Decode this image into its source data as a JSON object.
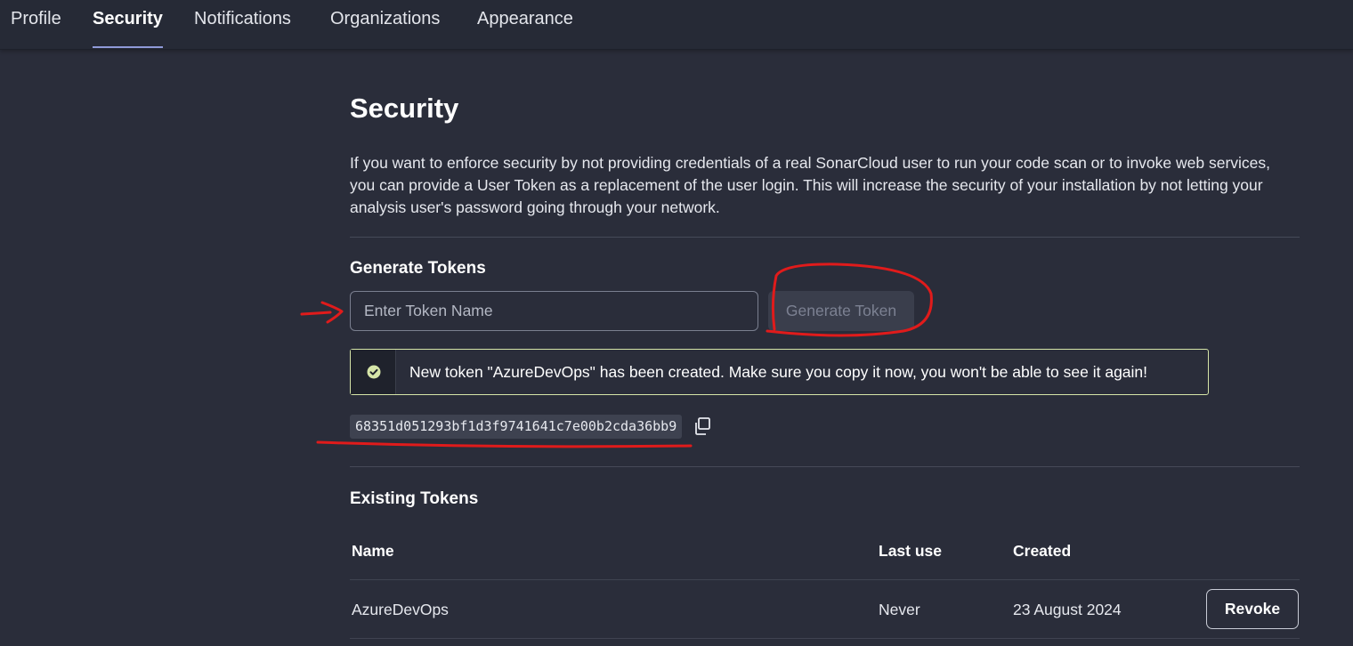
{
  "nav": {
    "tabs": [
      {
        "label": "Profile",
        "active": false
      },
      {
        "label": "Security",
        "active": true
      },
      {
        "label": "Notifications",
        "active": false
      },
      {
        "label": "Organizations",
        "active": false
      },
      {
        "label": "Appearance",
        "active": false
      }
    ]
  },
  "page": {
    "title": "Security",
    "description": "If you want to enforce security by not providing credentials of a real SonarCloud user to run your code scan or to invoke web services, you can provide a User Token as a replacement of the user login. This will increase the security of your installation by not letting your analysis user's password going through your network."
  },
  "generate": {
    "heading": "Generate Tokens",
    "input_value": "",
    "input_placeholder": "Enter Token Name",
    "button_label": "Generate Token",
    "button_disabled": true
  },
  "alert": {
    "icon": "check-circle-icon",
    "message": "New token \"AzureDevOps\" has been created. Make sure you copy it now, you won't be able to see it again!",
    "border_color": "#d6e5a8",
    "icon_color": "#d6e5a8"
  },
  "new_token": {
    "value": "68351d051293bf1d3f9741641c7e00b2cda36bb9",
    "copy_icon": "copy-icon"
  },
  "existing": {
    "heading": "Existing Tokens",
    "columns": {
      "name": "Name",
      "last_use": "Last use",
      "created": "Created"
    },
    "rows": [
      {
        "name": "AzureDevOps",
        "last_use": "Never",
        "created": "23 August 2024",
        "action_label": "Revoke"
      }
    ]
  },
  "colors": {
    "background": "#2a2d3a",
    "nav_background": "#262a36",
    "active_tab_underline": "#8f9ad8",
    "annotation_red": "#e01b1b"
  }
}
